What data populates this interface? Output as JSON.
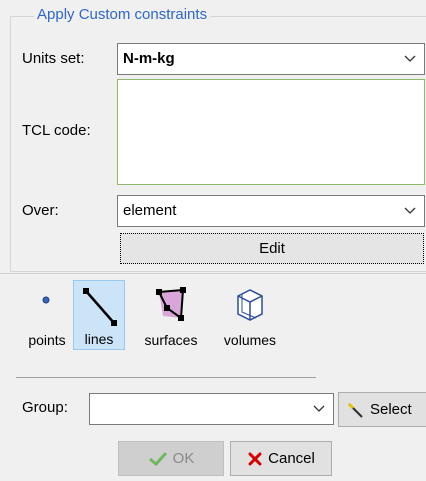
{
  "panel": {
    "title": "Apply Custom constraints",
    "units_label": "Units set:",
    "units_value": "N-m-kg",
    "tcl_label": "TCL code:",
    "tcl_value": "",
    "over_label": "Over:",
    "over_value": "element",
    "edit_label": "Edit"
  },
  "entity_tools": [
    {
      "label": "points",
      "icon": "point-icon",
      "selected": false
    },
    {
      "label": "lines",
      "icon": "line-icon",
      "selected": true
    },
    {
      "label": "surfaces",
      "icon": "surface-icon",
      "selected": false
    },
    {
      "label": "volumes",
      "icon": "volume-icon",
      "selected": false
    }
  ],
  "group": {
    "label": "Group:",
    "value": "",
    "select_label": "Select"
  },
  "footer": {
    "ok_label": "OK",
    "cancel_label": "Cancel"
  },
  "colors": {
    "title": "#2f67c8",
    "selected_tool_bg": "#cce4f7",
    "cancel_x": "#d40000",
    "ok_check": "#3aa02d"
  }
}
